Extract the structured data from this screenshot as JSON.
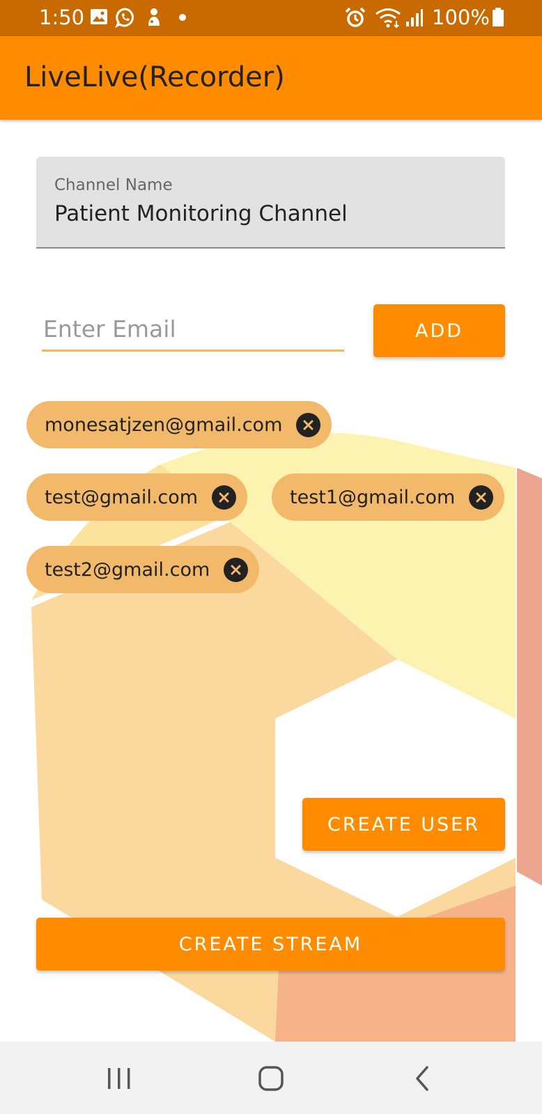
{
  "status_bar": {
    "time": "1:50",
    "battery": "100%",
    "icons": [
      "gallery-icon",
      "whatsapp-icon",
      "notification-icon",
      "dot-icon",
      "alarm-icon",
      "wifi-icon",
      "signal-icon",
      "battery-icon"
    ]
  },
  "app_bar": {
    "title": "LiveLive(Recorder)"
  },
  "channel": {
    "label": "Channel Name",
    "value": "Patient Monitoring Channel"
  },
  "email": {
    "placeholder": "Enter Email",
    "value": "",
    "add_label": "ADD"
  },
  "chips": [
    {
      "label": "monesatjzen@gmail.com"
    },
    {
      "label": "test@gmail.com"
    },
    {
      "label": "test1@gmail.com"
    },
    {
      "label": "test2@gmail.com"
    }
  ],
  "buttons": {
    "create_user": "CREATE USER",
    "create_stream": "CREATE STREAM"
  },
  "nav_bar": {
    "icons": [
      "recent-apps-icon",
      "home-icon",
      "back-icon"
    ]
  },
  "colors": {
    "status_bar": "#c96a00",
    "primary": "#ff8c00",
    "chip": "#f2b96a",
    "input_underline": "#f2b75a"
  }
}
